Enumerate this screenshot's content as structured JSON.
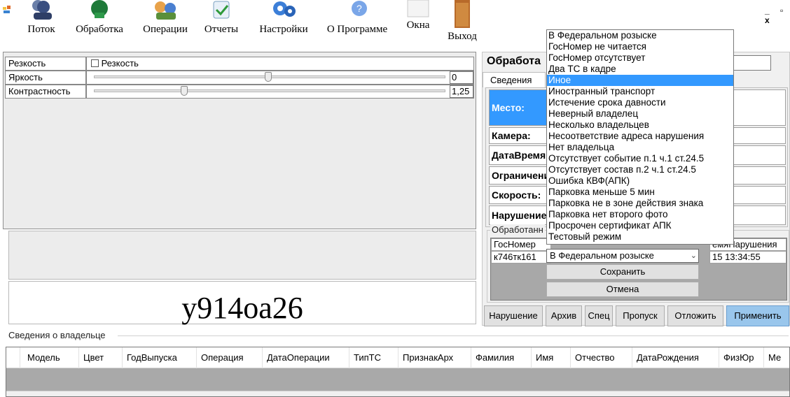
{
  "toolbar": {
    "items": [
      {
        "label": "Поток",
        "icon": "users-icon"
      },
      {
        "label": "Обработка",
        "icon": "processing-icon"
      },
      {
        "label": "Операции",
        "icon": "operations-icon"
      },
      {
        "label": "Отчеты",
        "icon": "reports-icon"
      },
      {
        "label": "Настройки",
        "icon": "settings-icon"
      },
      {
        "label": "О Программе",
        "icon": "about-icon"
      },
      {
        "label": "Окна",
        "icon": "windows-icon"
      },
      {
        "label": "Выход",
        "icon": "exit-door-icon"
      }
    ],
    "window_controls": "_ ▫ x"
  },
  "image_settings": {
    "sharpness_label": "Резкость",
    "sharpness_checkbox": "Резкость",
    "brightness_label": "Яркость",
    "brightness_value": "0",
    "contrast_label": "Контрастность",
    "contrast_value": "1,25"
  },
  "plate": "у914оа26",
  "processing": {
    "title": "Обработа",
    "tab_info": "Сведения",
    "rows": [
      {
        "key": "Место:",
        "value": ""
      },
      {
        "key": "Камера:",
        "value": ""
      },
      {
        "key": "ДатаВремя:",
        "value": ""
      },
      {
        "key": "Ограничени",
        "value": ""
      },
      {
        "key": "Скорость:",
        "value": ""
      },
      {
        "key": "Нарушение",
        "value": ""
      }
    ],
    "processed_group": "Обработанн",
    "table_headers": {
      "plate": "ГосНомер",
      "time": "емяНарушения"
    },
    "table_row": {
      "plate": "к746тк161",
      "time": "15 13:34:55"
    }
  },
  "reason_combo": {
    "selected": "В Федеральном розыске",
    "highlighted": "Иное",
    "options": [
      "В Федеральном розыске",
      "ГосНомер не читается",
      "ГосНомер отсутствует",
      "Два ТС в кадре",
      "Иное",
      "Иностранный транспорт",
      "Истечение срока давности",
      "Неверный владелец",
      "Несколько владельцев",
      "Несоответствие адреса нарушения",
      "Нет владельца",
      "Отсутствует событие п.1 ч.1 ст.24.5",
      "Отсутствует состав п.2 ч.1 ст.24.5",
      "Ошибка КВФ(АПК)",
      "Парковка меньше 5 мин",
      "Парковка не в зоне действия знака",
      "Парковка нет второго фото",
      "Просрочен сертификат АПК",
      "Тестовый режим"
    ],
    "save_label": "Сохранить",
    "cancel_label": "Отмена"
  },
  "action_buttons": {
    "violation": "Нарушение",
    "archive": "Архив",
    "special": "Спец",
    "skip": "Пропуск",
    "postpone": "Отложить",
    "apply": "Применить"
  },
  "owner": {
    "section_label": "Сведения о владельце",
    "columns": [
      "Модель",
      "Цвет",
      "ГодВыпуска",
      "Операция",
      "ДатаОперации",
      "ТипТС",
      "ПризнакАрх",
      "Фамилия",
      "Имя",
      "Отчество",
      "ДатаРождения",
      "ФизЮр",
      "Ме"
    ]
  },
  "colors": {
    "selection": "#3399ff",
    "apply_button": "#99c6ec"
  }
}
